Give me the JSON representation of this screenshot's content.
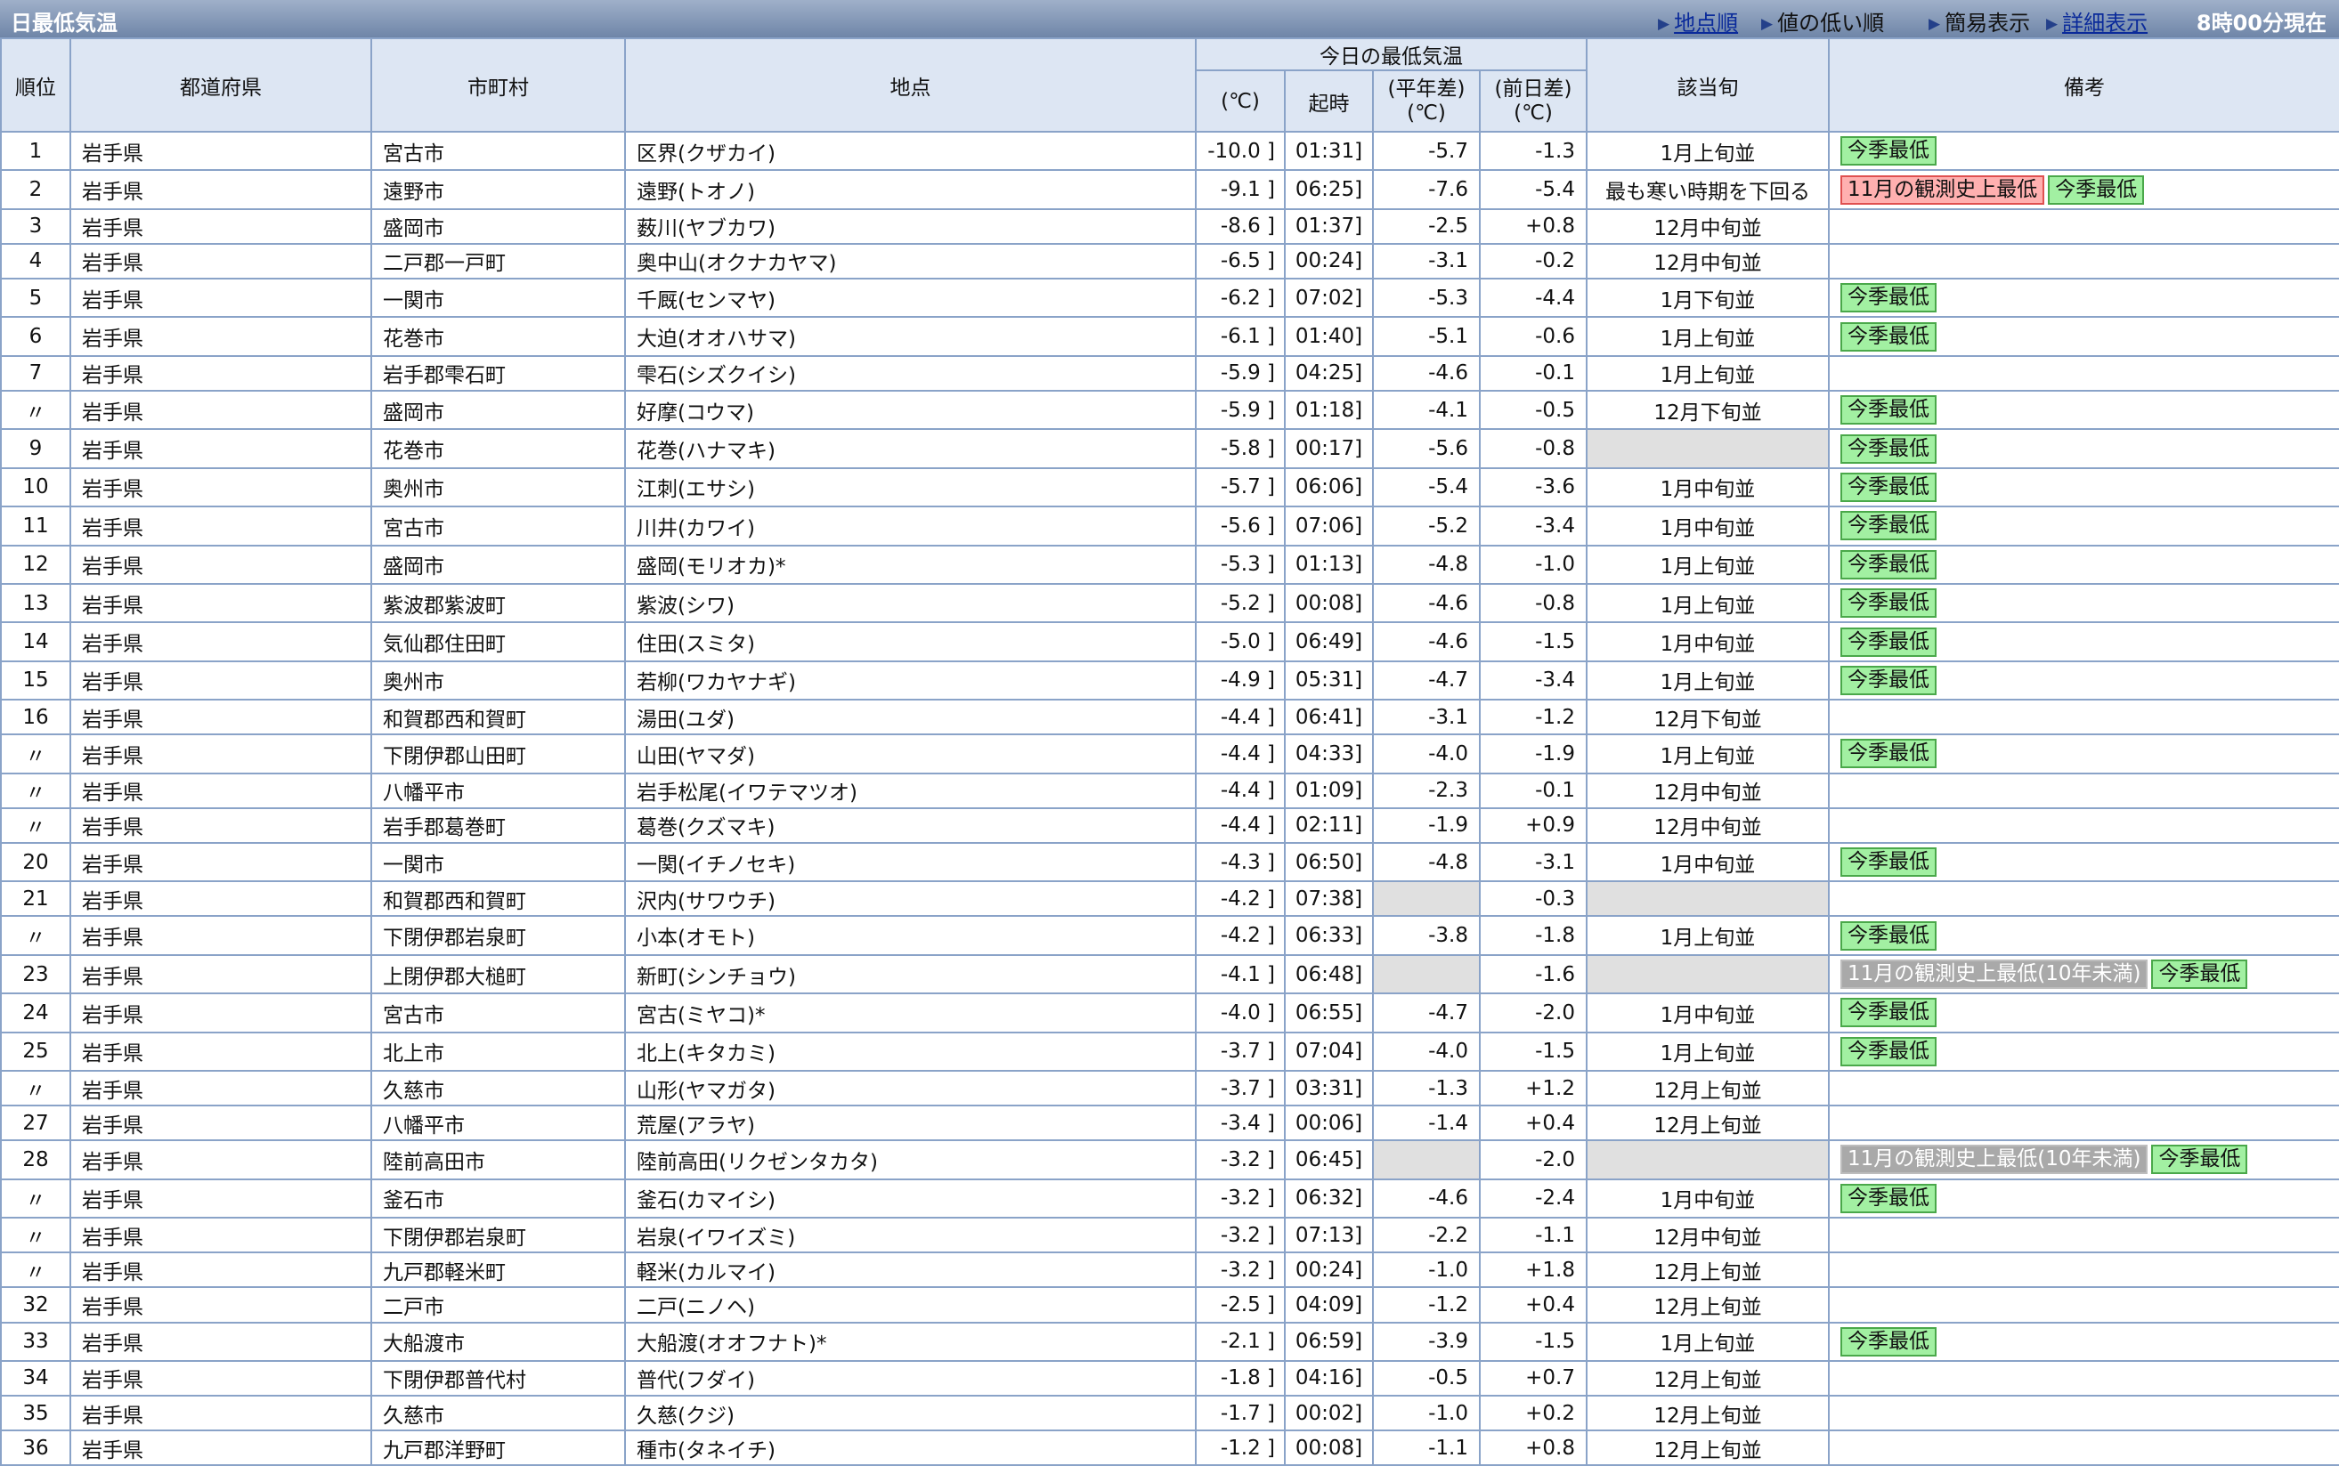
{
  "page": {
    "title": "日最低気温",
    "nav": [
      {
        "label": "地点順",
        "link": true
      },
      {
        "label": "値の低い順",
        "link": false
      },
      {
        "label": "簡易表示",
        "link": false
      },
      {
        "label": "詳細表示",
        "link": true
      }
    ],
    "current_time": "8時00分現在"
  },
  "columns": {
    "rank": "順位",
    "prefecture": "都道府県",
    "city": "市町村",
    "station": "地点",
    "group": "今日の最低気温",
    "temp": "(℃)",
    "time": "起時",
    "normal_diff": "(平年差)(℃)",
    "prev_diff": "(前日差)(℃)",
    "period": "該当旬",
    "notes": "備考"
  },
  "rows": [
    {
      "rank": "1",
      "pref": "岩手県",
      "city": "宮古市",
      "station": "区界(クザカイ)",
      "temp": "-10.0 ]",
      "time": "01:31]",
      "normal": "-5.7",
      "prev": "-1.3",
      "period": "1月上旬並",
      "notes": [
        {
          "text": "今季最低",
          "type": "green"
        }
      ]
    },
    {
      "rank": "2",
      "pref": "岩手県",
      "city": "遠野市",
      "station": "遠野(トオノ)",
      "temp": "-9.1 ]",
      "time": "06:25]",
      "normal": "-7.6",
      "prev": "-5.4",
      "period": "最も寒い時期を下回る",
      "notes": [
        {
          "text": "11月の観測史上最低",
          "type": "red"
        },
        {
          "text": "今季最低",
          "type": "green"
        }
      ]
    },
    {
      "rank": "3",
      "pref": "岩手県",
      "city": "盛岡市",
      "station": "薮川(ヤブカワ)",
      "temp": "-8.6 ]",
      "time": "01:37]",
      "normal": "-2.5",
      "prev": "+0.8",
      "period": "12月中旬並",
      "notes": []
    },
    {
      "rank": "4",
      "pref": "岩手県",
      "city": "二戸郡一戸町",
      "station": "奥中山(オクナカヤマ)",
      "temp": "-6.5 ]",
      "time": "00:24]",
      "normal": "-3.1",
      "prev": "-0.2",
      "period": "12月中旬並",
      "notes": []
    },
    {
      "rank": "5",
      "pref": "岩手県",
      "city": "一関市",
      "station": "千厩(センマヤ)",
      "temp": "-6.2 ]",
      "time": "07:02]",
      "normal": "-5.3",
      "prev": "-4.4",
      "period": "1月下旬並",
      "notes": [
        {
          "text": "今季最低",
          "type": "green"
        }
      ]
    },
    {
      "rank": "6",
      "pref": "岩手県",
      "city": "花巻市",
      "station": "大迫(オオハサマ)",
      "temp": "-6.1 ]",
      "time": "01:40]",
      "normal": "-5.1",
      "prev": "-0.6",
      "period": "1月上旬並",
      "notes": [
        {
          "text": "今季最低",
          "type": "green"
        }
      ]
    },
    {
      "rank": "7",
      "pref": "岩手県",
      "city": "岩手郡雫石町",
      "station": "雫石(シズクイシ)",
      "temp": "-5.9 ]",
      "time": "04:25]",
      "normal": "-4.6",
      "prev": "-0.1",
      "period": "1月上旬並",
      "notes": []
    },
    {
      "rank": "〃",
      "pref": "岩手県",
      "city": "盛岡市",
      "station": "好摩(コウマ)",
      "temp": "-5.9 ]",
      "time": "01:18]",
      "normal": "-4.1",
      "prev": "-0.5",
      "period": "12月下旬並",
      "notes": [
        {
          "text": "今季最低",
          "type": "green"
        }
      ]
    },
    {
      "rank": "9",
      "pref": "岩手県",
      "city": "花巻市",
      "station": "花巻(ハナマキ)",
      "temp": "-5.8 ]",
      "time": "00:17]",
      "normal": "-5.6",
      "prev": "-0.8",
      "period": "",
      "notes": [
        {
          "text": "今季最低",
          "type": "green"
        }
      ]
    },
    {
      "rank": "10",
      "pref": "岩手県",
      "city": "奥州市",
      "station": "江刺(エサシ)",
      "temp": "-5.7 ]",
      "time": "06:06]",
      "normal": "-5.4",
      "prev": "-3.6",
      "period": "1月中旬並",
      "notes": [
        {
          "text": "今季最低",
          "type": "green"
        }
      ]
    },
    {
      "rank": "11",
      "pref": "岩手県",
      "city": "宮古市",
      "station": "川井(カワイ)",
      "temp": "-5.6 ]",
      "time": "07:06]",
      "normal": "-5.2",
      "prev": "-3.4",
      "period": "1月中旬並",
      "notes": [
        {
          "text": "今季最低",
          "type": "green"
        }
      ]
    },
    {
      "rank": "12",
      "pref": "岩手県",
      "city": "盛岡市",
      "station": "盛岡(モリオカ)*",
      "temp": "-5.3 ]",
      "time": "01:13]",
      "normal": "-4.8",
      "prev": "-1.0",
      "period": "1月上旬並",
      "notes": [
        {
          "text": "今季最低",
          "type": "green"
        }
      ]
    },
    {
      "rank": "13",
      "pref": "岩手県",
      "city": "紫波郡紫波町",
      "station": "紫波(シワ)",
      "temp": "-5.2 ]",
      "time": "00:08]",
      "normal": "-4.6",
      "prev": "-0.8",
      "period": "1月上旬並",
      "notes": [
        {
          "text": "今季最低",
          "type": "green"
        }
      ]
    },
    {
      "rank": "14",
      "pref": "岩手県",
      "city": "気仙郡住田町",
      "station": "住田(スミタ)",
      "temp": "-5.0 ]",
      "time": "06:49]",
      "normal": "-4.6",
      "prev": "-1.5",
      "period": "1月中旬並",
      "notes": [
        {
          "text": "今季最低",
          "type": "green"
        }
      ]
    },
    {
      "rank": "15",
      "pref": "岩手県",
      "city": "奥州市",
      "station": "若柳(ワカヤナギ)",
      "temp": "-4.9 ]",
      "time": "05:31]",
      "normal": "-4.7",
      "prev": "-3.4",
      "period": "1月上旬並",
      "notes": [
        {
          "text": "今季最低",
          "type": "green"
        }
      ]
    },
    {
      "rank": "16",
      "pref": "岩手県",
      "city": "和賀郡西和賀町",
      "station": "湯田(ユダ)",
      "temp": "-4.4 ]",
      "time": "06:41]",
      "normal": "-3.1",
      "prev": "-1.2",
      "period": "12月下旬並",
      "notes": []
    },
    {
      "rank": "〃",
      "pref": "岩手県",
      "city": "下閉伊郡山田町",
      "station": "山田(ヤマダ)",
      "temp": "-4.4 ]",
      "time": "04:33]",
      "normal": "-4.0",
      "prev": "-1.9",
      "period": "1月上旬並",
      "notes": [
        {
          "text": "今季最低",
          "type": "green"
        }
      ]
    },
    {
      "rank": "〃",
      "pref": "岩手県",
      "city": "八幡平市",
      "station": "岩手松尾(イワテマツオ)",
      "temp": "-4.4 ]",
      "time": "01:09]",
      "normal": "-2.3",
      "prev": "-0.1",
      "period": "12月中旬並",
      "notes": []
    },
    {
      "rank": "〃",
      "pref": "岩手県",
      "city": "岩手郡葛巻町",
      "station": "葛巻(クズマキ)",
      "temp": "-4.4 ]",
      "time": "02:11]",
      "normal": "-1.9",
      "prev": "+0.9",
      "period": "12月中旬並",
      "notes": []
    },
    {
      "rank": "20",
      "pref": "岩手県",
      "city": "一関市",
      "station": "一関(イチノセキ)",
      "temp": "-4.3 ]",
      "time": "06:50]",
      "normal": "-4.8",
      "prev": "-3.1",
      "period": "1月中旬並",
      "notes": [
        {
          "text": "今季最低",
          "type": "green"
        }
      ]
    },
    {
      "rank": "21",
      "pref": "岩手県",
      "city": "和賀郡西和賀町",
      "station": "沢内(サワウチ)",
      "temp": "-4.2 ]",
      "time": "07:38]",
      "normal": "",
      "prev": "-0.3",
      "period": "",
      "notes": []
    },
    {
      "rank": "〃",
      "pref": "岩手県",
      "city": "下閉伊郡岩泉町",
      "station": "小本(オモト)",
      "temp": "-4.2 ]",
      "time": "06:33]",
      "normal": "-3.8",
      "prev": "-1.8",
      "period": "1月上旬並",
      "notes": [
        {
          "text": "今季最低",
          "type": "green"
        }
      ]
    },
    {
      "rank": "23",
      "pref": "岩手県",
      "city": "上閉伊郡大槌町",
      "station": "新町(シンチョウ)",
      "temp": "-4.1 ]",
      "time": "06:48]",
      "normal": "",
      "prev": "-1.6",
      "period": "",
      "notes": [
        {
          "text": "11月の観測史上最低(10年未満)",
          "type": "dim"
        },
        {
          "text": "今季最低",
          "type": "green"
        }
      ]
    },
    {
      "rank": "24",
      "pref": "岩手県",
      "city": "宮古市",
      "station": "宮古(ミヤコ)*",
      "temp": "-4.0 ]",
      "time": "06:55]",
      "normal": "-4.7",
      "prev": "-2.0",
      "period": "1月中旬並",
      "notes": [
        {
          "text": "今季最低",
          "type": "green"
        }
      ]
    },
    {
      "rank": "25",
      "pref": "岩手県",
      "city": "北上市",
      "station": "北上(キタカミ)",
      "temp": "-3.7 ]",
      "time": "07:04]",
      "normal": "-4.0",
      "prev": "-1.5",
      "period": "1月上旬並",
      "notes": [
        {
          "text": "今季最低",
          "type": "green"
        }
      ]
    },
    {
      "rank": "〃",
      "pref": "岩手県",
      "city": "久慈市",
      "station": "山形(ヤマガタ)",
      "temp": "-3.7 ]",
      "time": "03:31]",
      "normal": "-1.3",
      "prev": "+1.2",
      "period": "12月上旬並",
      "notes": []
    },
    {
      "rank": "27",
      "pref": "岩手県",
      "city": "八幡平市",
      "station": "荒屋(アラヤ)",
      "temp": "-3.4 ]",
      "time": "00:06]",
      "normal": "-1.4",
      "prev": "+0.4",
      "period": "12月上旬並",
      "notes": []
    },
    {
      "rank": "28",
      "pref": "岩手県",
      "city": "陸前高田市",
      "station": "陸前高田(リクゼンタカタ)",
      "temp": "-3.2 ]",
      "time": "06:45]",
      "normal": "",
      "prev": "-2.0",
      "period": "",
      "notes": [
        {
          "text": "11月の観測史上最低(10年未満)",
          "type": "dim"
        },
        {
          "text": "今季最低",
          "type": "green"
        }
      ]
    },
    {
      "rank": "〃",
      "pref": "岩手県",
      "city": "釜石市",
      "station": "釜石(カマイシ)",
      "temp": "-3.2 ]",
      "time": "06:32]",
      "normal": "-4.6",
      "prev": "-2.4",
      "period": "1月中旬並",
      "notes": [
        {
          "text": "今季最低",
          "type": "green"
        }
      ]
    },
    {
      "rank": "〃",
      "pref": "岩手県",
      "city": "下閉伊郡岩泉町",
      "station": "岩泉(イワイズミ)",
      "temp": "-3.2 ]",
      "time": "07:13]",
      "normal": "-2.2",
      "prev": "-1.1",
      "period": "12月中旬並",
      "notes": []
    },
    {
      "rank": "〃",
      "pref": "岩手県",
      "city": "九戸郡軽米町",
      "station": "軽米(カルマイ)",
      "temp": "-3.2 ]",
      "time": "00:24]",
      "normal": "-1.0",
      "prev": "+1.8",
      "period": "12月上旬並",
      "notes": []
    },
    {
      "rank": "32",
      "pref": "岩手県",
      "city": "二戸市",
      "station": "二戸(ニノヘ)",
      "temp": "-2.5 ]",
      "time": "04:09]",
      "normal": "-1.2",
      "prev": "+0.4",
      "period": "12月上旬並",
      "notes": []
    },
    {
      "rank": "33",
      "pref": "岩手県",
      "city": "大船渡市",
      "station": "大船渡(オオフナト)*",
      "temp": "-2.1 ]",
      "time": "06:59]",
      "normal": "-3.9",
      "prev": "-1.5",
      "period": "1月上旬並",
      "notes": [
        {
          "text": "今季最低",
          "type": "green"
        }
      ]
    },
    {
      "rank": "34",
      "pref": "岩手県",
      "city": "下閉伊郡普代村",
      "station": "普代(フダイ)",
      "temp": "-1.8 ]",
      "time": "04:16]",
      "normal": "-0.5",
      "prev": "+0.7",
      "period": "12月上旬並",
      "notes": []
    },
    {
      "rank": "35",
      "pref": "岩手県",
      "city": "久慈市",
      "station": "久慈(クジ)",
      "temp": "-1.7 ]",
      "time": "00:02]",
      "normal": "-1.0",
      "prev": "+0.2",
      "period": "12月上旬並",
      "notes": []
    },
    {
      "rank": "36",
      "pref": "岩手県",
      "city": "九戸郡洋野町",
      "station": "種市(タネイチ)",
      "temp": "-1.2 ]",
      "time": "00:08]",
      "normal": "-1.1",
      "prev": "+0.8",
      "period": "12月上旬並",
      "notes": []
    }
  ]
}
